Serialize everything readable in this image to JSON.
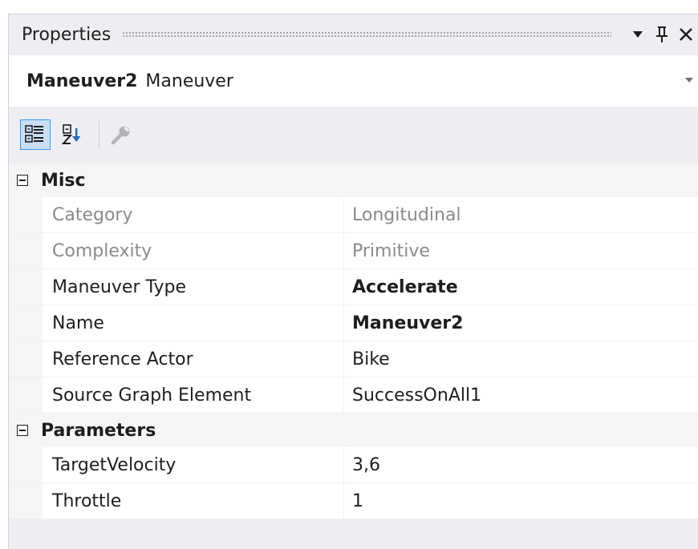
{
  "window": {
    "title": "Properties",
    "dropdown_icon": "triangle-down-icon",
    "pin_icon": "pushpin-icon",
    "close_icon": "close-icon"
  },
  "selector": {
    "object_name": "Maneuver2",
    "object_type": "Maneuver"
  },
  "toolbar": {
    "categorized_icon": "categorized-icon",
    "alphabetical_icon": "alphabetical-sort-icon",
    "property_pages_icon": "wrench-icon"
  },
  "grid": {
    "categories": [
      {
        "label": "Misc",
        "properties": [
          {
            "name": "Category",
            "value": "Longitudinal"
          },
          {
            "name": "Complexity",
            "value": "Primitive"
          },
          {
            "name": "Maneuver Type",
            "value": "Accelerate"
          },
          {
            "name": "Name",
            "value": "Maneuver2"
          },
          {
            "name": "Reference Actor",
            "value": "Bike"
          },
          {
            "name": "Source Graph Element",
            "value": "SuccessOnAll1"
          }
        ]
      },
      {
        "label": "Parameters",
        "properties": [
          {
            "name": "TargetVelocity",
            "value": "3,6"
          },
          {
            "name": "Throttle",
            "value": "1"
          }
        ]
      }
    ]
  },
  "colors": {
    "accent": "#3399ff",
    "readonly_text": "#8a8a8a",
    "pane_background": "#eeeef2"
  }
}
